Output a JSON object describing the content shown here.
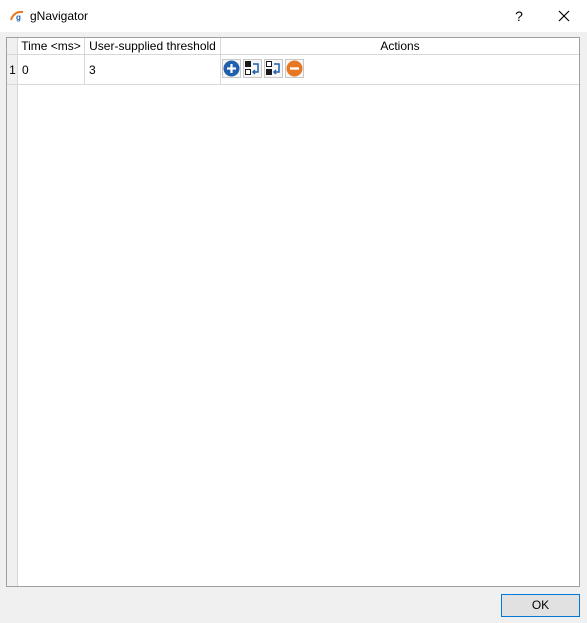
{
  "window": {
    "title": "gNavigator",
    "help_label": "?",
    "app_icon": "gnavigator-logo-icon",
    "close_icon": "close-icon"
  },
  "table": {
    "columns": [
      "Time <ms>",
      "User-supplied threshold",
      "Actions"
    ],
    "rows": [
      {
        "row_number": "1",
        "time": "0",
        "threshold": "3",
        "actions": [
          "add-row-icon",
          "move-up-icon",
          "move-down-icon",
          "remove-row-icon"
        ]
      }
    ]
  },
  "footer": {
    "ok_label": "OK"
  },
  "colors": {
    "add_blue": "#1f5fae",
    "remove_orange": "#e87722",
    "focus_blue": "#0078d7"
  }
}
